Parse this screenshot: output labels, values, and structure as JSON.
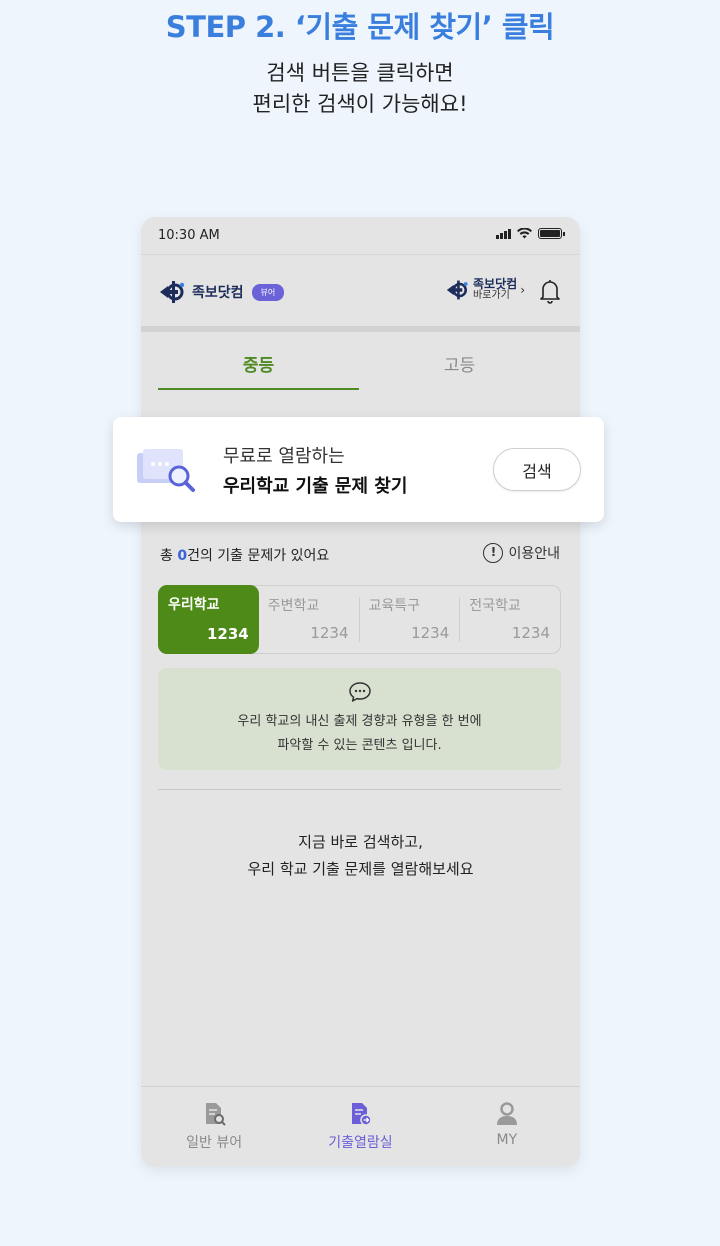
{
  "step": {
    "title": "STEP 2. ‘기출 문제 찾기’ 클릭",
    "desc_line1": "검색 버튼을 클릭하면",
    "desc_line2": "편리한 검색이 가능해요!"
  },
  "status_bar": {
    "time": "10:30 AM"
  },
  "app_bar": {
    "logo_text": "족보닷컴",
    "viewer_badge": "뷰어",
    "shortcut_name": "족보닷컴",
    "shortcut_sub": "바로가기",
    "shortcut_chevron": "›"
  },
  "level_tabs": [
    {
      "label": "중등",
      "active": true
    },
    {
      "label": "고등",
      "active": false
    }
  ],
  "search_card": {
    "subtitle": "무료로 열람하는",
    "title": "우리학교 기출 문제 찾기",
    "button_label": "검색"
  },
  "summary": {
    "prefix": "총 ",
    "count": "0",
    "suffix": "건의 기출 문제가 있어요",
    "guide_label": "이용안내",
    "guide_icon_glyph": "!"
  },
  "school_tabs": [
    {
      "label": "우리학교",
      "count": "1234",
      "active": true
    },
    {
      "label": "주변학교",
      "count": "1234",
      "active": false
    },
    {
      "label": "교육특구",
      "count": "1234",
      "active": false
    },
    {
      "label": "전국학교",
      "count": "1234",
      "active": false
    }
  ],
  "notice": {
    "line1": "우리 학교의 내신 출제 경향과 유형을 한 번에",
    "line2": "파악할 수 있는 콘텐츠 입니다."
  },
  "empty_message": {
    "line1": "지금 바로 검색하고,",
    "line2": "우리 학교 기출 문제를 열람해보세요"
  },
  "bottom_nav": [
    {
      "label": "일반 뷰어",
      "icon": "document-search-icon",
      "active": false
    },
    {
      "label": "기출열람실",
      "icon": "document-arrow-icon",
      "active": true
    },
    {
      "label": "MY",
      "icon": "user-icon",
      "active": false
    }
  ],
  "colors": {
    "step_title": "#3a7fde",
    "active_tab_green": "#4f8a23",
    "school_tab_active": "#4d8a17",
    "viewer_badge": "#6c62d8",
    "nav_active": "#6a5fd8",
    "count_blue": "#3a62d8",
    "notice_bg": "#d8e1d0",
    "page_bg": "#eef5fd"
  }
}
